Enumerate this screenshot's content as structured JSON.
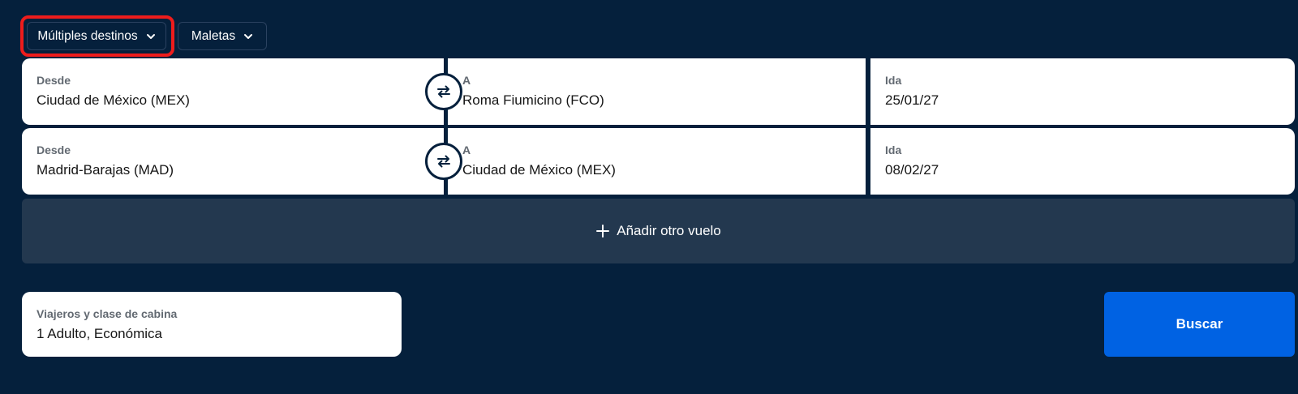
{
  "trip_type": {
    "label": "Múltiples destinos",
    "icon": "chevron-down-icon"
  },
  "bags": {
    "label": "Maletas",
    "icon": "chevron-down-icon"
  },
  "flights": [
    {
      "from_label": "Desde",
      "from_value": "Ciudad de México (MEX)",
      "to_label": "A",
      "to_value": "Roma Fiumicino (FCO)",
      "date_label": "Ida",
      "date_value": "25/01/27"
    },
    {
      "from_label": "Desde",
      "from_value": "Madrid-Barajas (MAD)",
      "to_label": "A",
      "to_value": "Ciudad de México (MEX)",
      "date_label": "Ida",
      "date_value": "08/02/27"
    }
  ],
  "add_flight": {
    "label": "Añadir otro vuelo",
    "icon": "plus-icon"
  },
  "travellers": {
    "label": "Viajeros y clase de cabina",
    "value": "1 Adulto, Económica"
  },
  "search": {
    "label": "Buscar"
  },
  "colors": {
    "background": "#05203c",
    "panel": "#23384f",
    "field": "#ffffff",
    "accent": "#0062e3",
    "highlight": "#ee1c1c"
  }
}
